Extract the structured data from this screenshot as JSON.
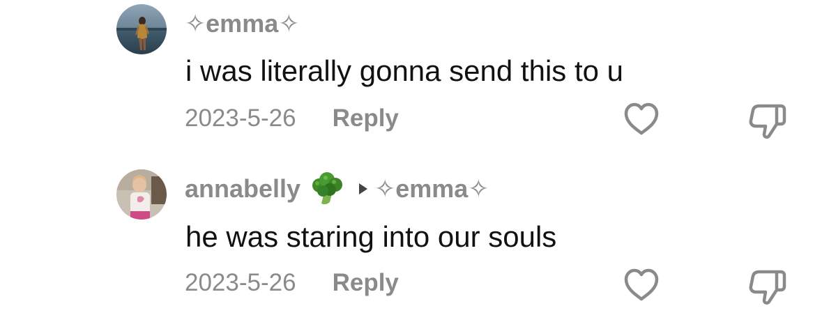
{
  "comments": [
    {
      "author": "✧emma✧",
      "text": "i was literally gonna send this to u",
      "date": "2023-5-26",
      "reply_label": "Reply",
      "avatar_icon": "profile-photo",
      "like_icon": "heart-outline-icon",
      "dislike_icon": "thumbs-down-outline-icon"
    },
    {
      "author": "annabelly",
      "author_emoji": "broccoli-emoji",
      "reply_to": "✧emma✧",
      "text": "he was staring into our souls",
      "date": "2023-5-26",
      "reply_label": "Reply",
      "avatar_icon": "profile-photo",
      "like_icon": "heart-outline-icon",
      "dislike_icon": "thumbs-down-outline-icon"
    }
  ],
  "colors": {
    "username": "#8a8a8a",
    "body_text": "#111111",
    "meta": "#8a8a8a",
    "icon": "#8a8a8a",
    "background": "#ffffff"
  }
}
